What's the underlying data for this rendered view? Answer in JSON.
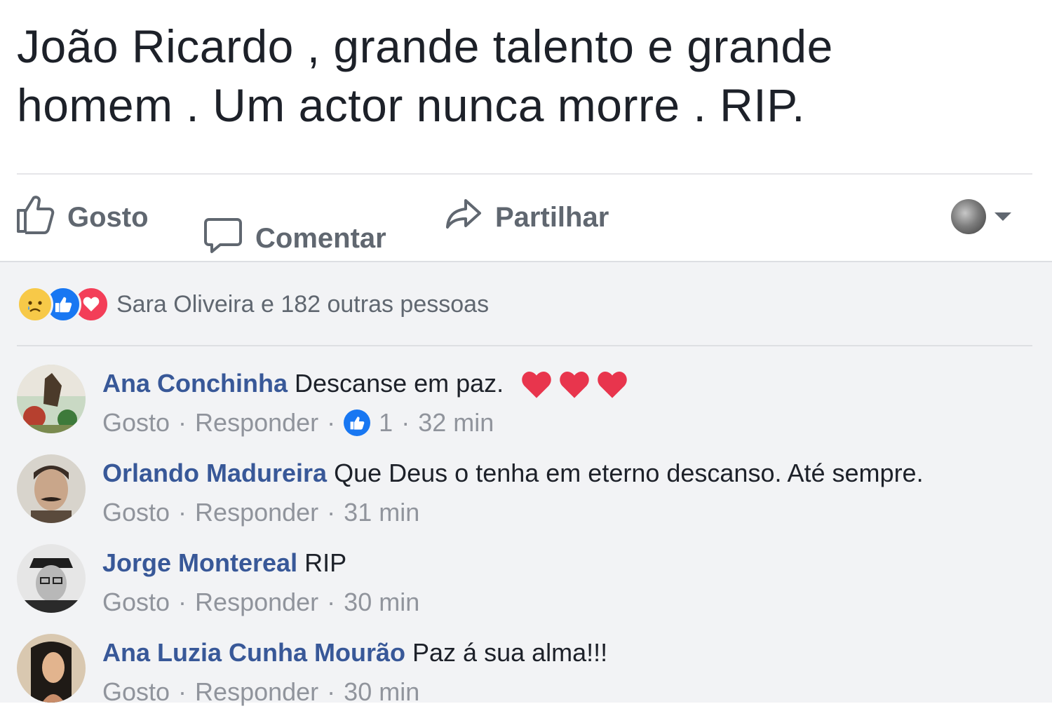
{
  "post": {
    "text": "João Ricardo , grande talento e grande homem . Um actor nunca morre . RIP."
  },
  "actions": {
    "like_label": "Gosto",
    "comment_label": "Comentar",
    "share_label": "Partilhar"
  },
  "reactions": {
    "summary": "Sara Oliveira e 182 outras pessoas",
    "types": [
      "sad",
      "like",
      "love"
    ]
  },
  "comments": [
    {
      "author": "Ana Conchinha",
      "text": "Descanse em paz.",
      "emoji": "3 red hearts",
      "like": "Gosto",
      "reply": "Responder",
      "like_count": "1",
      "time": "32 min"
    },
    {
      "author": "Orlando Madureira",
      "text": "Que Deus o tenha em eterno descanso. Até sempre.",
      "like": "Gosto",
      "reply": "Responder",
      "time": "31 min"
    },
    {
      "author": "Jorge Montereal",
      "text": "RIP",
      "like": "Gosto",
      "reply": "Responder",
      "time": "30 min"
    },
    {
      "author": "Ana Luzia Cunha Mourão",
      "text": "Paz á sua alma!!!",
      "like": "Gosto",
      "reply": "Responder",
      "time": "30 min"
    }
  ],
  "colors": {
    "author_link": "#385898",
    "meta": "#90949c",
    "like_blue": "#1877f2",
    "love_red": "#f33e58",
    "comments_bg": "#f2f3f5"
  }
}
